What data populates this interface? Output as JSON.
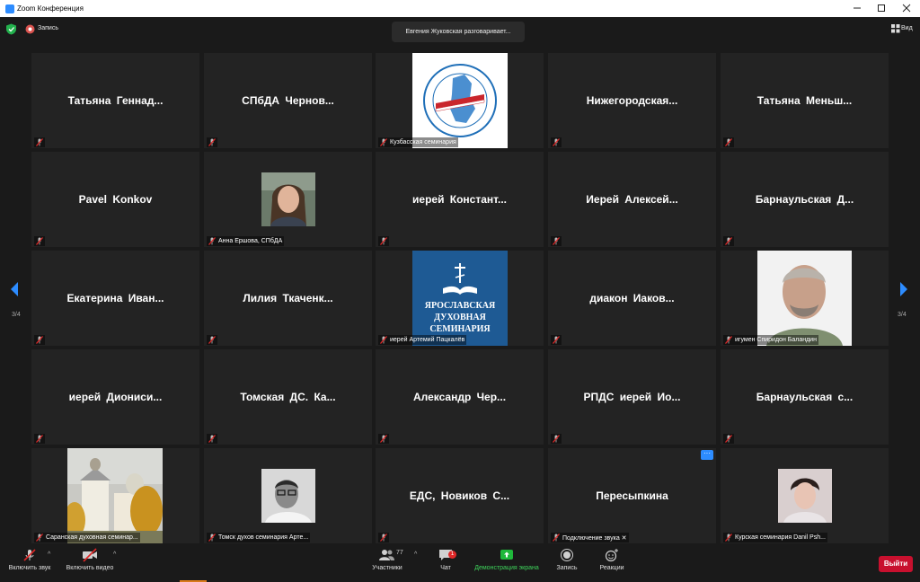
{
  "window": {
    "title": "Zoom Конференция"
  },
  "topbar": {
    "recording_label": "Запись",
    "speaking": "Евгения Жуковская разговаривает...",
    "view_label": "Вид"
  },
  "nav": {
    "left_page": "3/4",
    "right_page": "3/4"
  },
  "tiles": [
    {
      "name": "Татьяна  Геннад...",
      "label": ""
    },
    {
      "name": "СПбДА  Чернов...",
      "label": ""
    },
    {
      "name": "",
      "label": "Кузбасская семинария",
      "image": "kuzbass-seminary-logo"
    },
    {
      "name": "Нижегородская...",
      "label": ""
    },
    {
      "name": "Татьяна  Меньш...",
      "label": ""
    },
    {
      "name": "Pavel Konkov",
      "label": ""
    },
    {
      "name": "",
      "label": "Анна Ершова, СПбДА",
      "image": "woman-photo"
    },
    {
      "name": "иерей  Констант...",
      "label": ""
    },
    {
      "name": "Иерей  Алексей...",
      "label": ""
    },
    {
      "name": "Барнаульская  Д...",
      "label": ""
    },
    {
      "name": "Екатерина  Иван...",
      "label": ""
    },
    {
      "name": "Лилия  Ткаченк...",
      "label": ""
    },
    {
      "name": "",
      "label": "иерей Артемий Пацкалёв",
      "image": "yaroslavl-seminary-logo",
      "logo_text": [
        "ЯРОСЛАВСКАЯ",
        "ДУХОВНАЯ",
        "СЕМИНАРИЯ"
      ]
    },
    {
      "name": "диакон  Иаков...",
      "label": ""
    },
    {
      "name": "",
      "label": "игумен Спиридон Баландин",
      "image": "man-photo"
    },
    {
      "name": "иерей  Диониси...",
      "label": ""
    },
    {
      "name": "Томская  ДС.  Ка...",
      "label": ""
    },
    {
      "name": "Александр  Чер...",
      "label": ""
    },
    {
      "name": "РПДС  иерей  Ио...",
      "label": ""
    },
    {
      "name": "Барнаульская  с...",
      "label": ""
    },
    {
      "name": "",
      "label": "Саранская духовная семинар...",
      "image": "church-photo"
    },
    {
      "name": "",
      "label": "Томск духов семинария Арте...",
      "image": "man-glasses-photo"
    },
    {
      "name": "ЕДС,  Новиков  С...",
      "label": ""
    },
    {
      "name": "Пересыпкина",
      "label": "Подключение звука ✕",
      "more_badge": "···"
    },
    {
      "name": "",
      "label": "Курская семинария Danil Psh...",
      "image": "young-man-photo"
    }
  ],
  "toolbar": {
    "unmute_label": "Включить звук",
    "video_label": "Включить видео",
    "participants_label": "Участники",
    "participants_count": "77",
    "chat_label": "Чат",
    "chat_badge": "1",
    "share_label": "Демонстрация экрана",
    "record_label": "Запись",
    "reactions_label": "Реакции",
    "leave_label": "Выйти"
  },
  "colors": {
    "accent": "#2d8cff",
    "leave": "#c8102e",
    "share": "#1fb93b",
    "muted_mic": "#e02828"
  }
}
